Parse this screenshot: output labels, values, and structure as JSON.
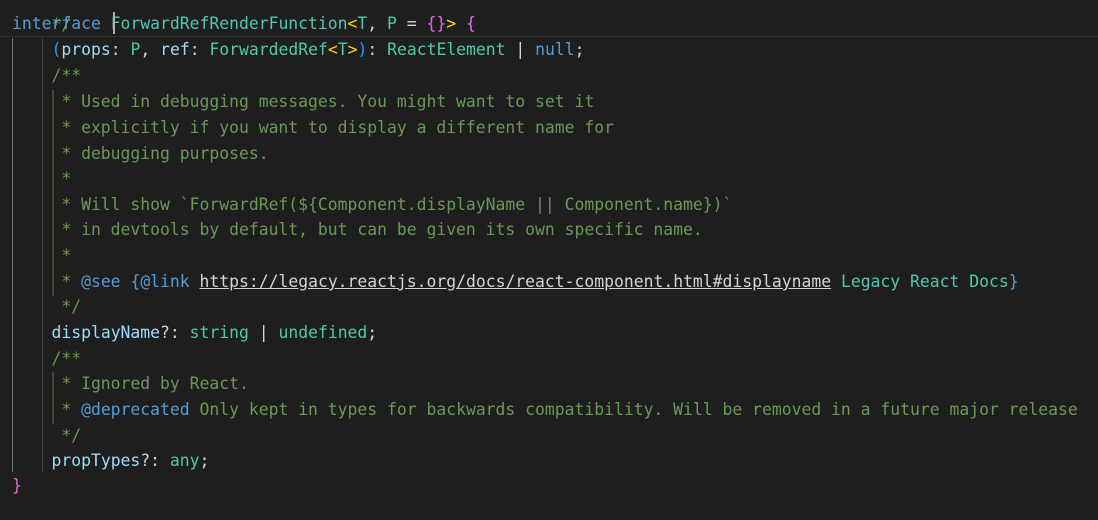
{
  "code": {
    "line0": "*/",
    "line1": {
      "kw": "interface",
      "name": "ForwardRefRenderFunction",
      "lt": "<",
      "tp1": "T",
      "sep": ", ",
      "tp2": "P",
      "eq": " = ",
      "obj": "{}",
      "gt": ">",
      "sp": " ",
      "open": "{"
    },
    "line2": {
      "indent": "    ",
      "lp": "(",
      "p1": "props",
      "c1": ": ",
      "t1": "P",
      "comma": ", ",
      "p2": "ref",
      "c2": ": ",
      "t2": "ForwardedRef",
      "lt": "<",
      "t3": "T",
      "gt": ">",
      "rp": ")",
      "c3": ": ",
      "t4": "ReactElement",
      "bar": " | ",
      "t5": "null",
      "semi": ";"
    },
    "line3": "    /**",
    "line4": "     * Used in debugging messages. You might want to set it",
    "line5": "     * explicitly if you want to display a different name for",
    "line6": "     * debugging purposes.",
    "line7": "     *",
    "line8": "     * Will show `ForwardRef(${Component.displayName || Component.name})`",
    "line9": "     * in devtools by default, but can be given its own specific name.",
    "line10": "     *",
    "line11": {
      "pre": "     * ",
      "tag": "@see",
      "sp": " ",
      "lb": "{",
      "link": "@link",
      "sp2": " ",
      "url": "https://legacy.reactjs.org/docs/react-component.html#displayname",
      "text": " Legacy React Docs",
      "rb": "}"
    },
    "line12": "     */",
    "line13": {
      "indent": "    ",
      "prop": "displayName",
      "opt": "?: ",
      "t1": "string",
      "bar": " | ",
      "t2": "undefined",
      "semi": ";"
    },
    "line14": "    /**",
    "line15": "     * Ignored by React.",
    "line16": {
      "pre": "     * ",
      "tag": "@deprecated",
      "text": " Only kept in types for backwards compatibility. Will be removed in a future major release"
    },
    "line17": "     */",
    "line18": {
      "indent": "    ",
      "prop": "propTypes",
      "opt": "?: ",
      "t1": "any",
      "semi": ";"
    },
    "line19": "}"
  }
}
